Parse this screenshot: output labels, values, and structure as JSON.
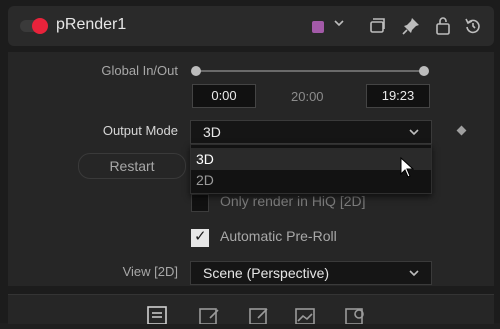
{
  "node": {
    "name": "pRender1",
    "swatch_color": "#a35aa8"
  },
  "header_icons": [
    "toggle-icon",
    "color-swatch",
    "chevron-down-icon",
    "duplicate-icon",
    "pin-icon",
    "lock-icon",
    "reset-icon"
  ],
  "global_inout": {
    "label": "Global In/Out",
    "start": "0:00",
    "mid": "20:00",
    "end": "19:23"
  },
  "output_mode": {
    "label": "Output Mode",
    "value": "3D",
    "options": [
      "3D",
      "2D"
    ],
    "selected_option": "3D"
  },
  "restart_label": "Restart",
  "checkboxes": [
    {
      "label": "Only render in HiQ [2D]",
      "checked": false
    },
    {
      "label": "Automatic Pre-Roll",
      "checked": true
    }
  ],
  "view": {
    "label": "View [2D]",
    "value": "Scene (Perspective)"
  },
  "footer_tabs": [
    "controls-tab-icon",
    "scene-tab-icon",
    "render-tab-icon",
    "image-tab-icon",
    "settings-tab-icon"
  ]
}
